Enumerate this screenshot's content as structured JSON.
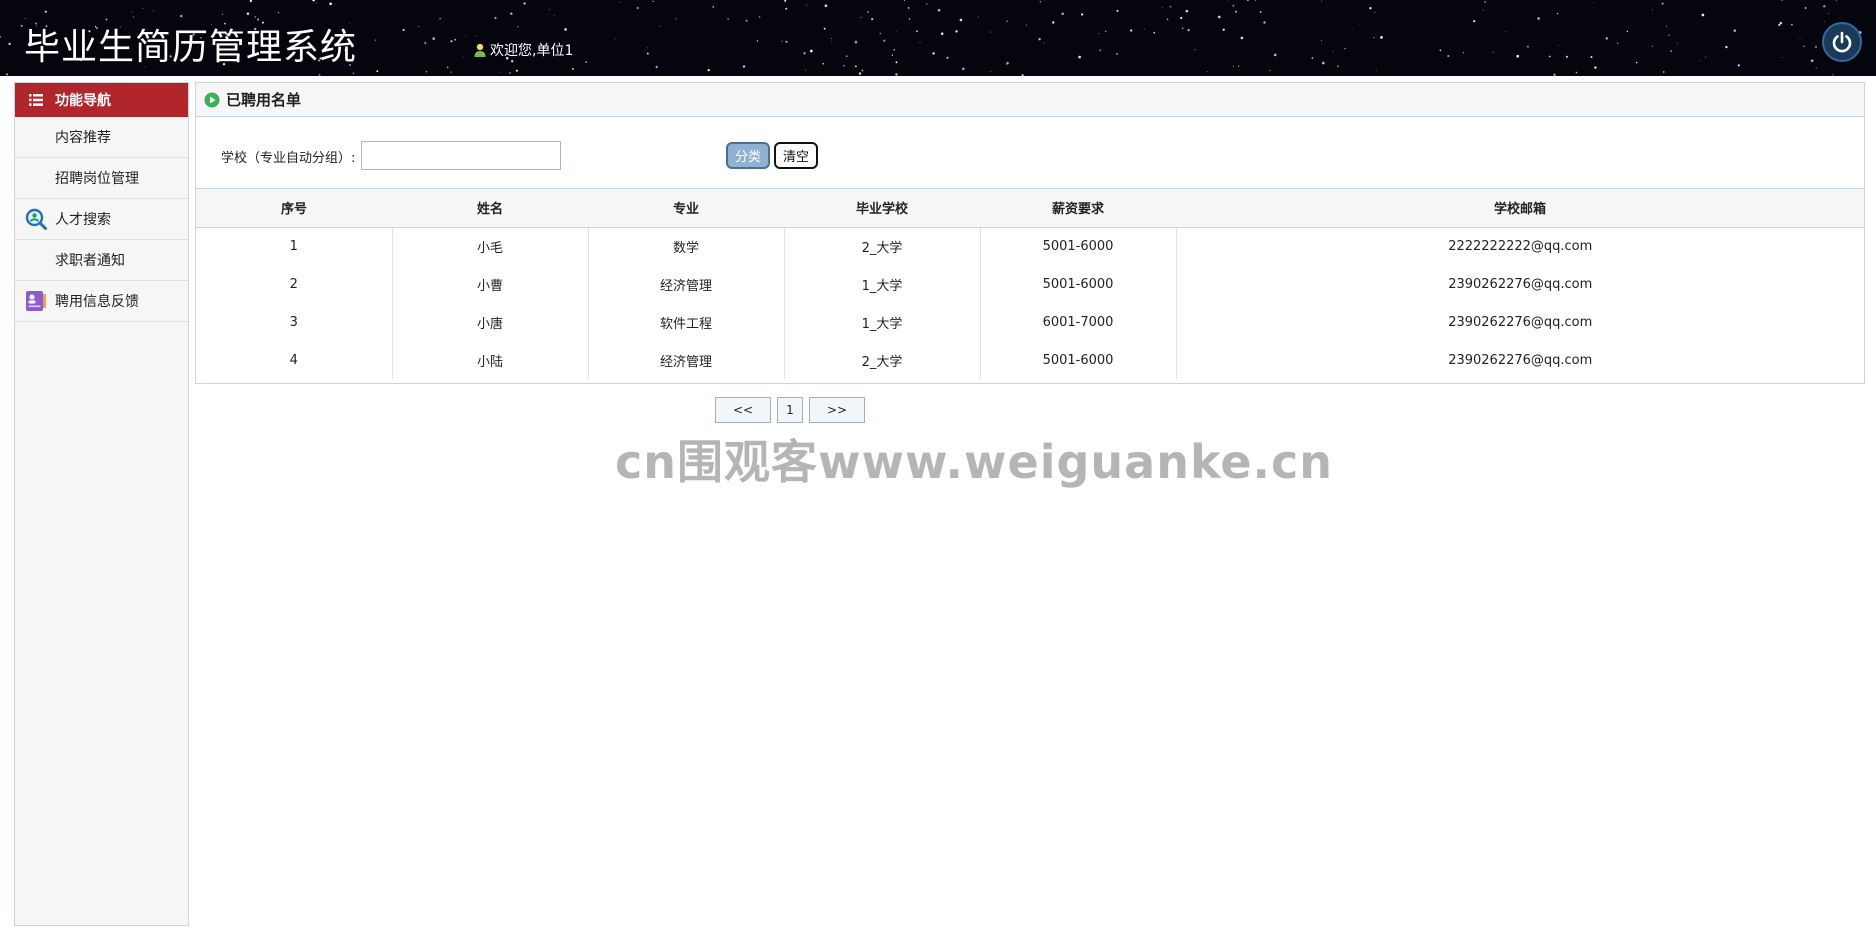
{
  "header": {
    "title": "毕业生简历管理系统",
    "welcome": "欢迎您,单位1"
  },
  "sidebar": {
    "heading": "功能导航",
    "items": [
      {
        "label": "内容推荐",
        "icon": ""
      },
      {
        "label": "招聘岗位管理",
        "icon": ""
      },
      {
        "label": "人才搜索",
        "icon": "search-people-icon"
      },
      {
        "label": "求职者通知",
        "icon": ""
      },
      {
        "label": "聘用信息反馈",
        "icon": "profile-card-icon"
      }
    ]
  },
  "panel": {
    "title": "已聘用名单",
    "filter_label": "学校（专业自动分组）:",
    "filter_value": "",
    "classify_label": "分类",
    "clear_label": "清空"
  },
  "table": {
    "columns": [
      "序号",
      "姓名",
      "专业",
      "毕业学校",
      "薪资要求",
      "学校邮箱"
    ],
    "rows": [
      [
        "1",
        "小毛",
        "数学",
        "2_大学",
        "5001-6000",
        "2222222222@qq.com"
      ],
      [
        "2",
        "小曹",
        "经济管理",
        "1_大学",
        "5001-6000",
        "2390262276@qq.com"
      ],
      [
        "3",
        "小唐",
        "软件工程",
        "1_大学",
        "6001-7000",
        "2390262276@qq.com"
      ],
      [
        "4",
        "小陆",
        "经济管理",
        "2_大学",
        "5001-6000",
        "2390262276@qq.com"
      ]
    ]
  },
  "pagination": {
    "prev": "<<",
    "current": "1",
    "next": ">>"
  },
  "watermark": "cn围观客www.weiguanke.cn",
  "colors": {
    "nav_active": "#b1262a",
    "header_bg": "#05060d",
    "classify_button": "#8fb2d3"
  }
}
